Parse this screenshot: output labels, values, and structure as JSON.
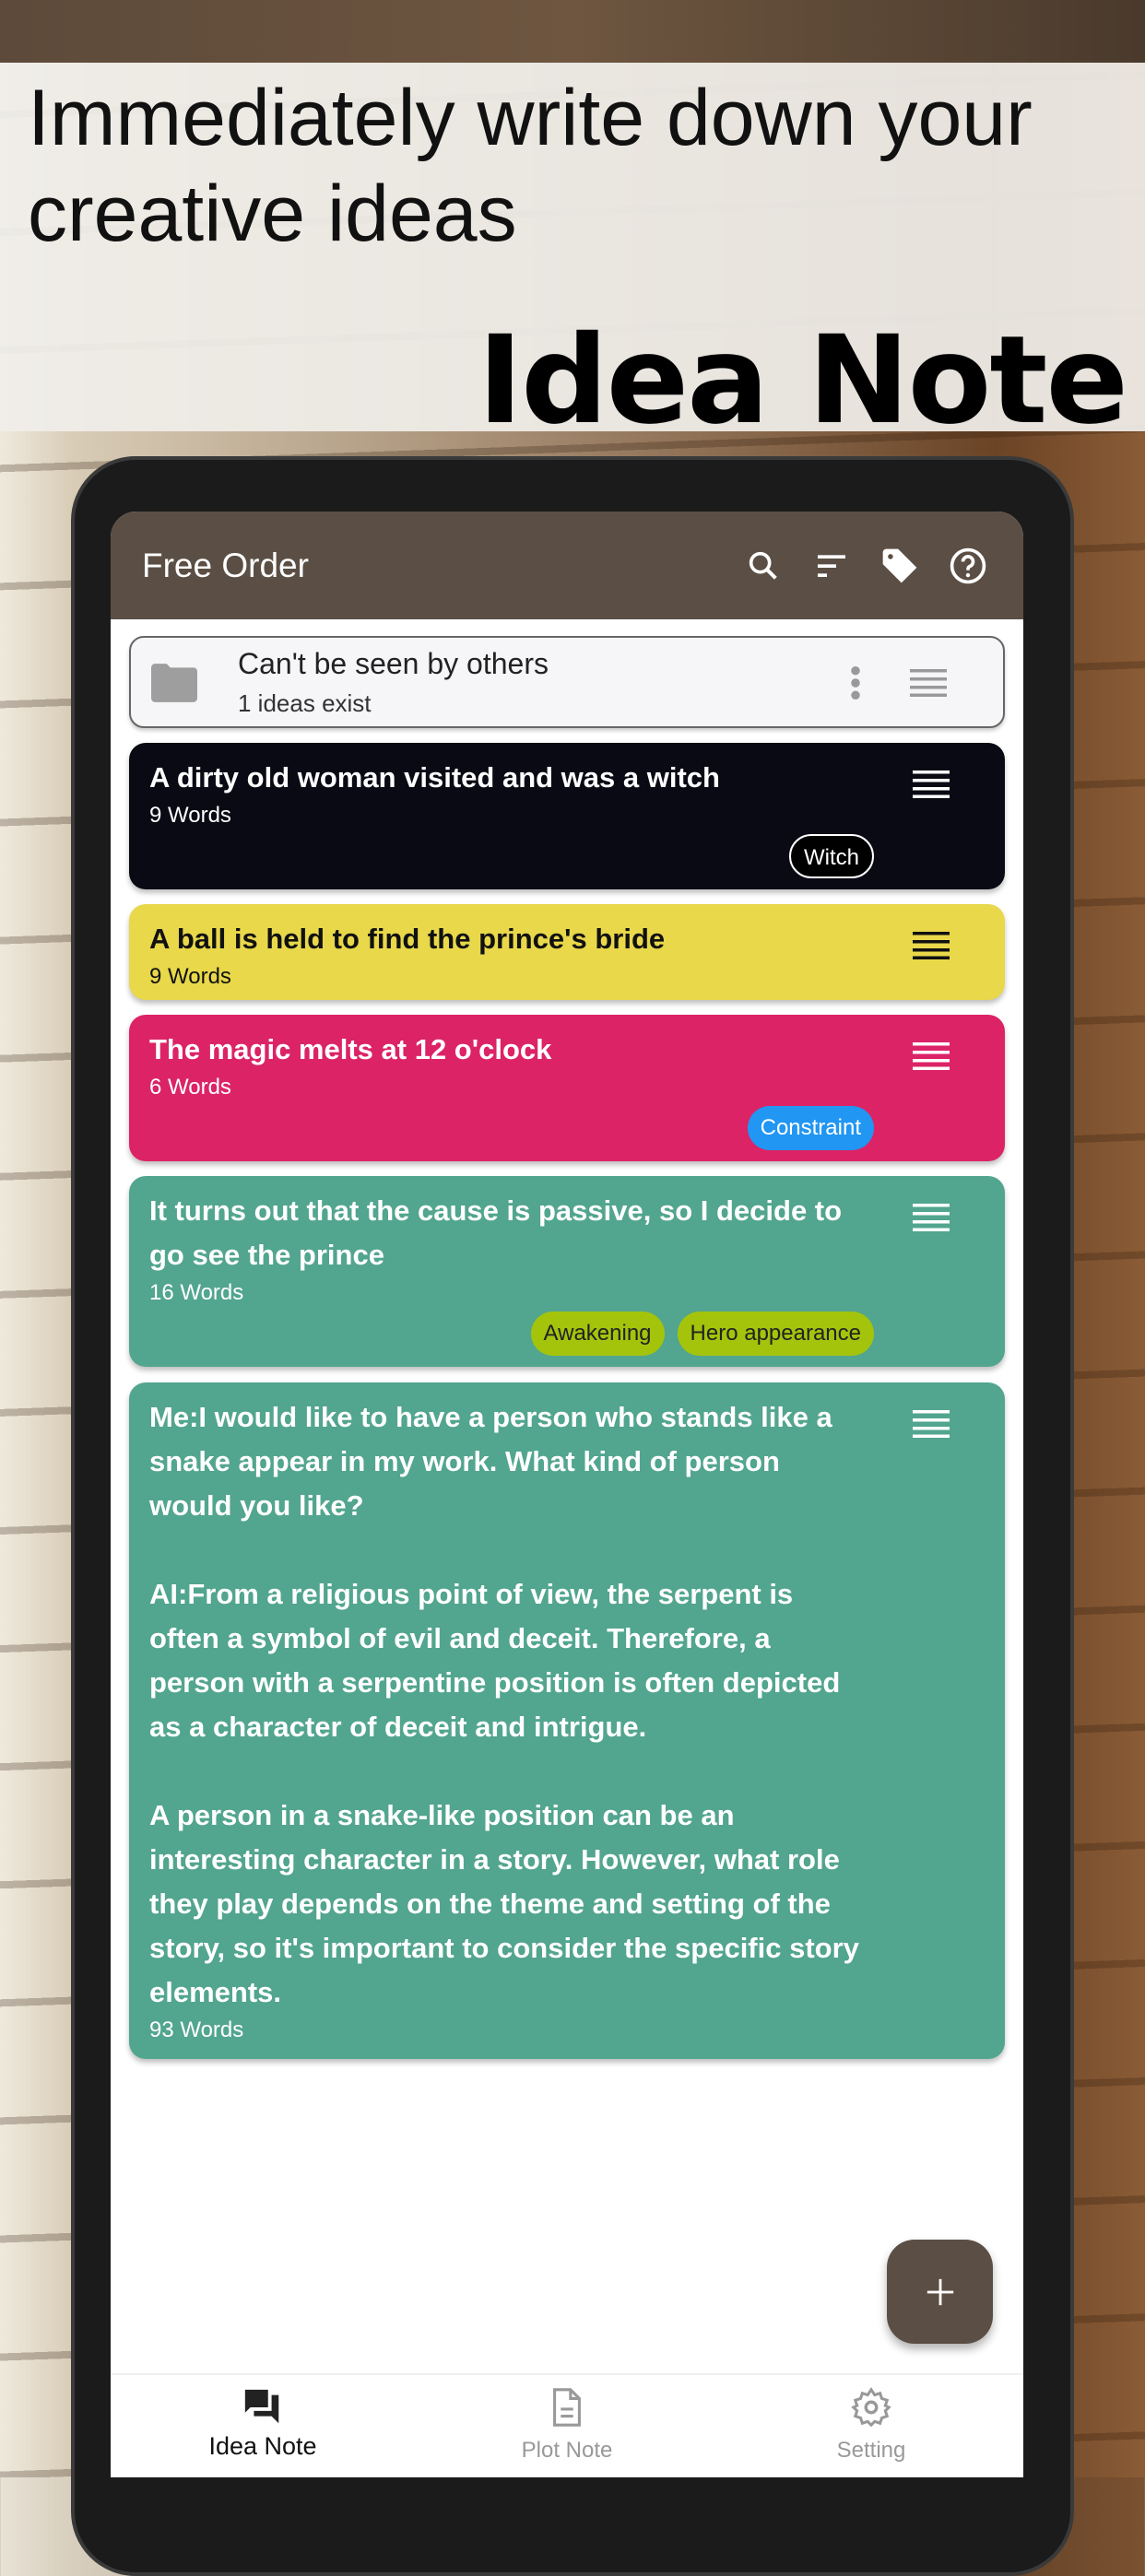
{
  "banner": {
    "tagline": "Immediately write down your creative ideas",
    "app_name": "Idea Note"
  },
  "appbar": {
    "title": "Free Order",
    "icons": [
      "search-icon",
      "sort-icon",
      "tag-icon",
      "help-icon"
    ]
  },
  "folder": {
    "title": "Can't be seen by others",
    "subtitle": "1 ideas exist"
  },
  "cards": [
    {
      "title": "A dirty old woman visited and was a witch",
      "words": "9 Words",
      "color": "#0a0a14",
      "text_color": "#ffffff",
      "tags": [
        {
          "label": "Witch",
          "bg": "#000000",
          "fg": "#ffffff"
        }
      ]
    },
    {
      "title": "A ball is held to find the prince's bride",
      "words": "9 Words",
      "color": "#e8d84a",
      "text_color": "#111111",
      "tags": []
    },
    {
      "title": "The magic melts at 12 o'clock",
      "words": "6 Words",
      "color": "#dc2366",
      "text_color": "#ffffff",
      "tags": [
        {
          "label": "Constraint",
          "bg": "#2196f3",
          "fg": "#ffffff"
        }
      ]
    },
    {
      "title": "It turns out that the cause is passive, so I decide to go see the prince",
      "words": "16 Words",
      "color": "#52a58e",
      "text_color": "#ffffff",
      "tags": [
        {
          "label": "Awakening",
          "bg": "#a4c40c",
          "fg": "#222222"
        },
        {
          "label": "Hero appearance",
          "bg": "#a4c40c",
          "fg": "#222222"
        }
      ]
    },
    {
      "title": "Me:I would like to have a person who stands like a snake appear in my work. What kind of person would you like?\n\nAI:From a religious point of view, the serpent is often a symbol of evil and deceit. Therefore, a person with a serpentine position is often depicted as a character of deceit and intrigue.\n\nA person in a snake-like position can be an interesting character in a story. However, what role they play depends on the theme and setting of the story, so it's important to consider the specific story elements.",
      "words": "93 Words",
      "color": "#52a58e",
      "text_color": "#ffffff",
      "tags": []
    }
  ],
  "fab": {
    "icon": "plus-icon"
  },
  "nav": [
    {
      "label": "Idea Note",
      "icon": "chat-icon",
      "active": true
    },
    {
      "label": "Plot Note",
      "icon": "document-icon",
      "active": false
    },
    {
      "label": "Setting",
      "icon": "gear-icon",
      "active": false
    }
  ]
}
